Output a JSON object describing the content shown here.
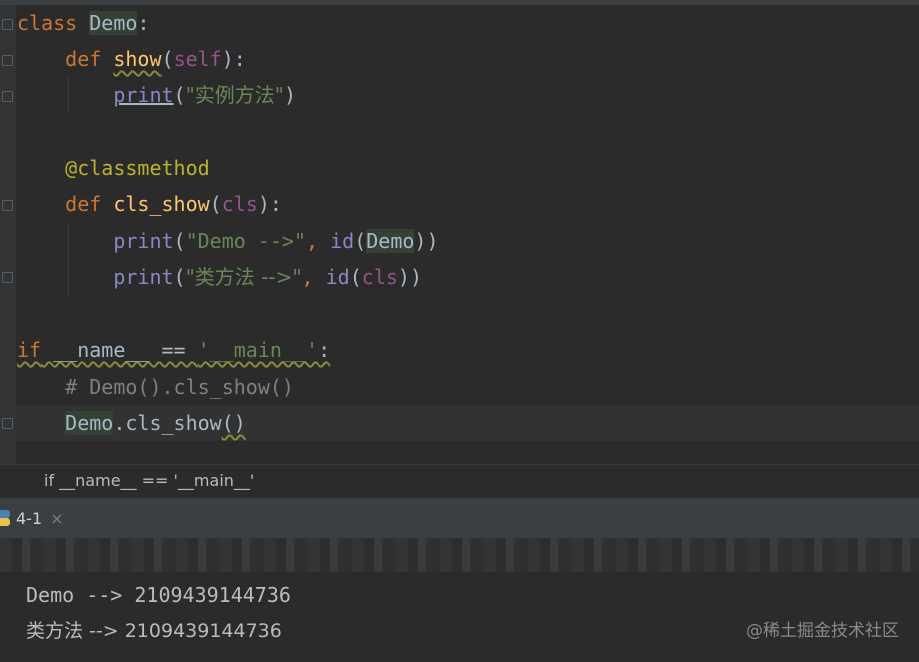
{
  "editor": {
    "lines": {
      "l1": {
        "kw": "class",
        "name": "Demo",
        "colon": ":"
      },
      "l2": {
        "kw": "def",
        "name": "show",
        "paren_open": "(",
        "self": "self",
        "paren_close": "):"
      },
      "l3": {
        "fn": "print",
        "open": "(",
        "str": "\"实例方法\"",
        "close": ")"
      },
      "l5": {
        "deco": "@classmethod"
      },
      "l6": {
        "kw": "def",
        "name": "cls_show",
        "paren_open": "(",
        "cls": "cls",
        "paren_close": "):"
      },
      "l7": {
        "fn": "print",
        "open": "(",
        "str": "\"Demo -->\"",
        "comma": ", ",
        "id": "id",
        "id_open": "(",
        "arg": "Demo",
        "id_close": "))"
      },
      "l8": {
        "fn": "print",
        "open": "(",
        "str": "\"类方法 -->\"",
        "comma": ", ",
        "id": "id",
        "id_open": "(",
        "arg": "cls",
        "id_close": "))"
      },
      "l10": {
        "kw": "if",
        "name": " __name__ == ",
        "str": "'__main__'",
        "colon": ":"
      },
      "l11": {
        "comment": "# Demo().cls_show()"
      },
      "l12": {
        "cls": "Demo",
        "dot_call": ".cls_show",
        "parens": "()"
      }
    }
  },
  "breadcrumb": {
    "text": "if __name__ == '__main__'"
  },
  "run_panel": {
    "tab_label": "4-1",
    "close_glyph": "×",
    "output": [
      "Demo --> 2109439144736",
      "类方法 --> 2109439144736"
    ]
  },
  "watermark": "@稀土掘金技术社区",
  "colors": {
    "background": "#2b2b2b",
    "keyword": "#cc7832",
    "function": "#ffc66d",
    "string": "#6a8759",
    "builtin": "#8888c6",
    "decorator": "#bbb529",
    "self": "#94558d"
  }
}
